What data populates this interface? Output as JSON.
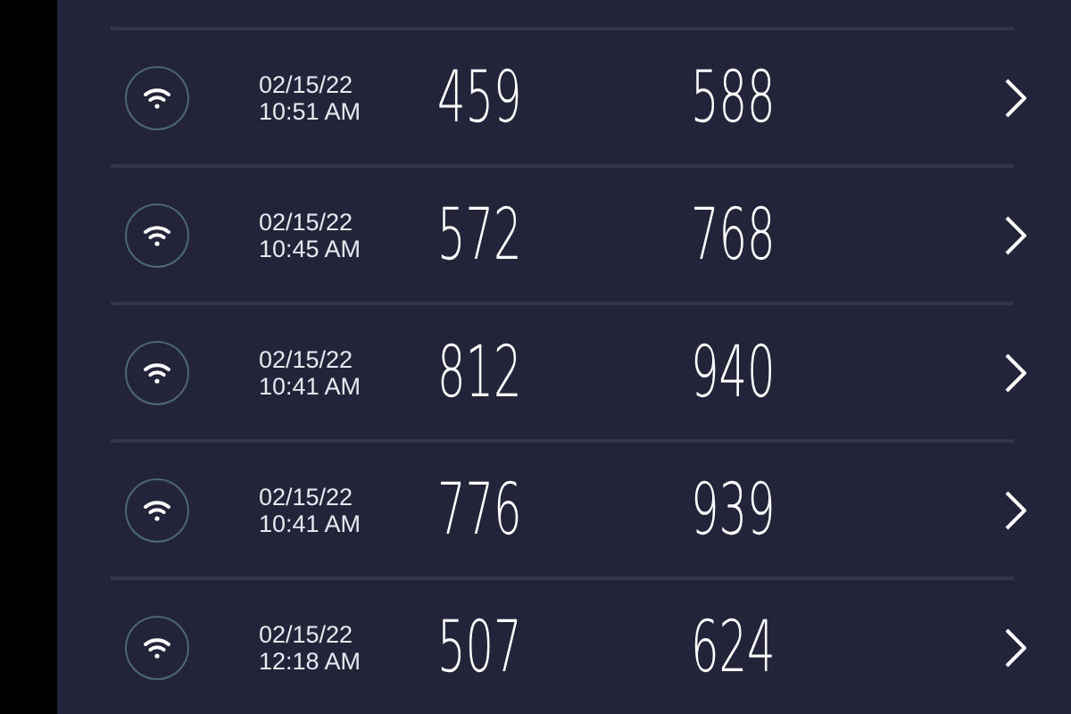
{
  "readings": [
    {
      "date": "02/15/22",
      "time": "10:51 AM",
      "value_1": "459",
      "value_2": "588"
    },
    {
      "date": "02/15/22",
      "time": "10:45 AM",
      "value_1": "572",
      "value_2": "768"
    },
    {
      "date": "02/15/22",
      "time": "10:41 AM",
      "value_1": "812",
      "value_2": "940"
    },
    {
      "date": "02/15/22",
      "time": "10:41 AM",
      "value_1": "776",
      "value_2": "939"
    },
    {
      "date": "02/15/22",
      "time": "12:18 AM",
      "value_1": "507",
      "value_2": "624"
    }
  ]
}
